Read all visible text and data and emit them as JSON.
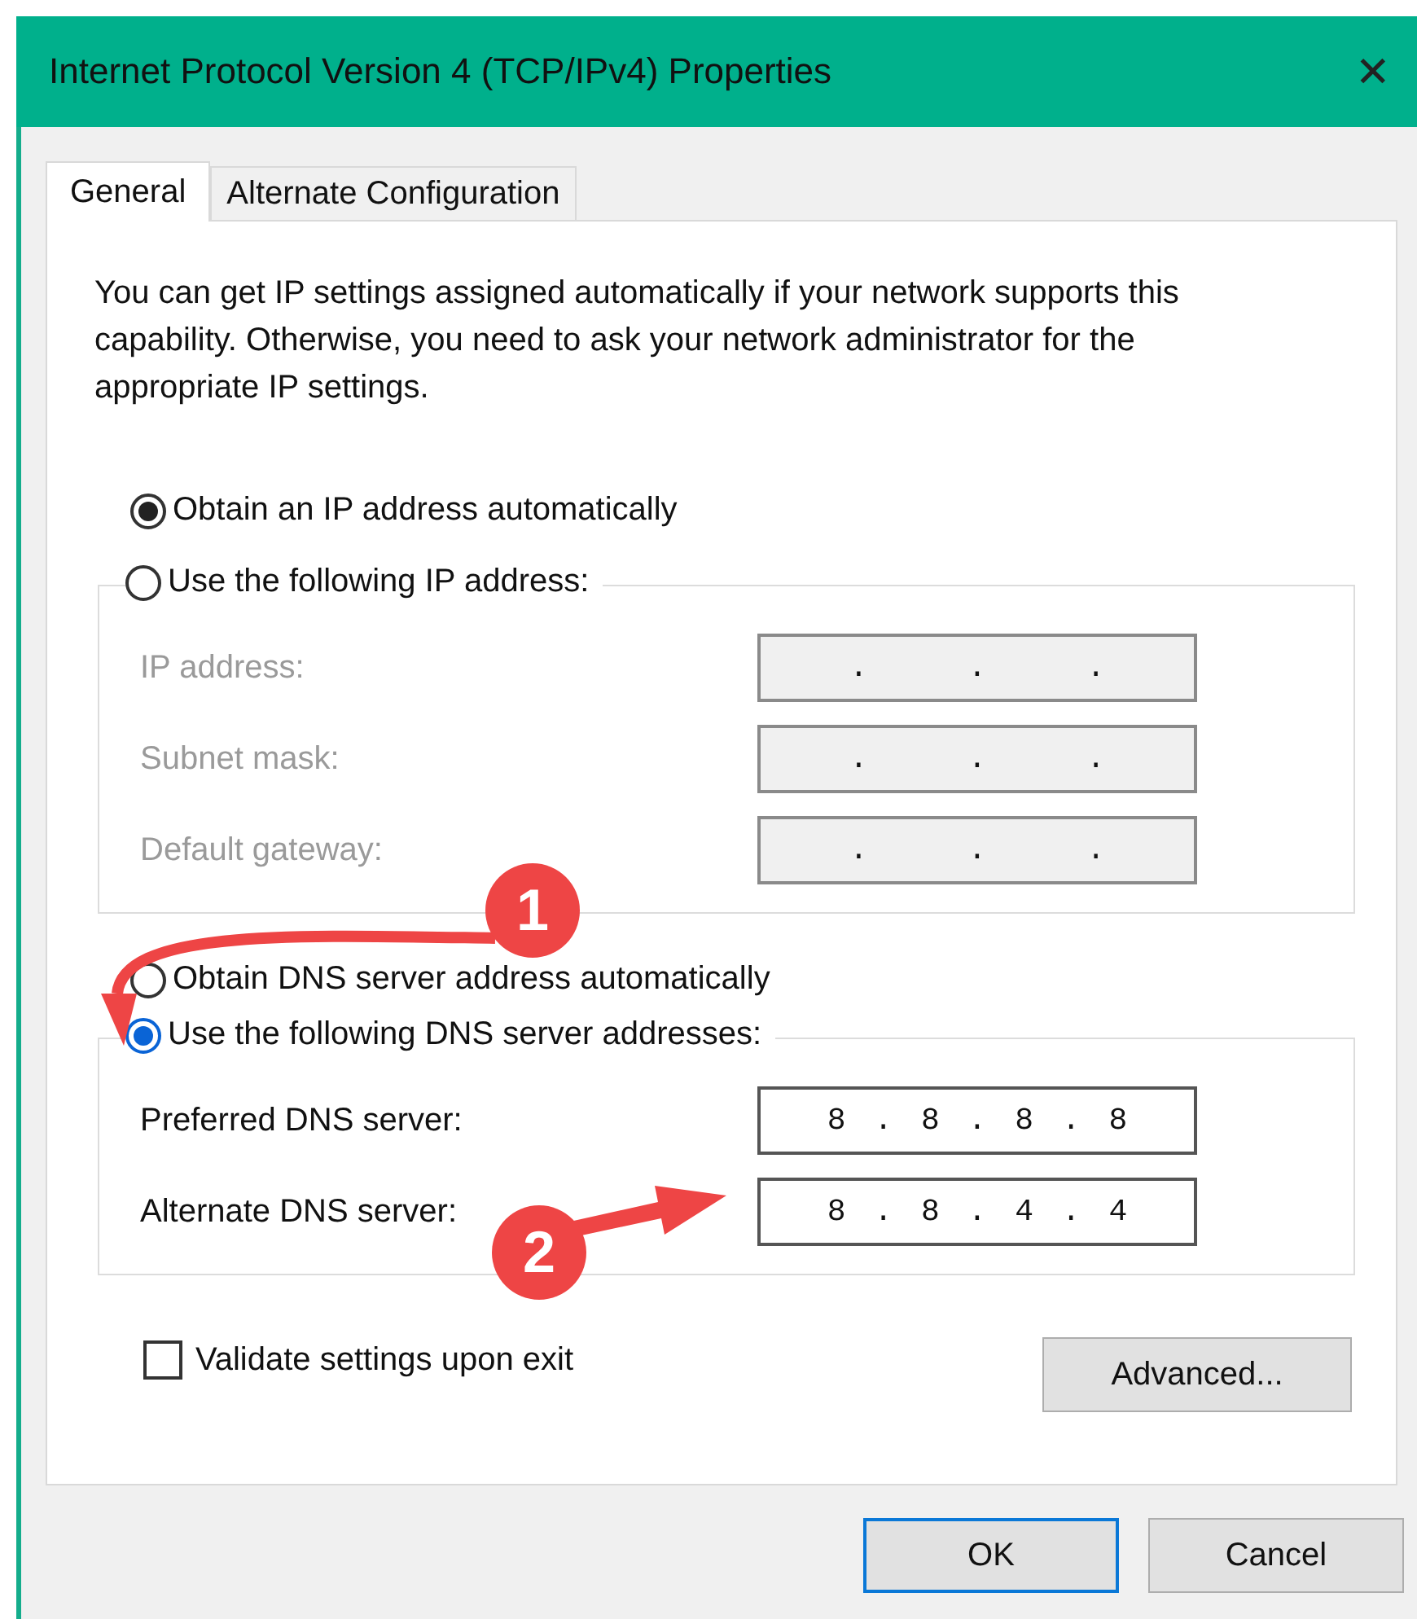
{
  "window": {
    "title": "Internet Protocol Version 4 (TCP/IPv4) Properties",
    "close": "✕"
  },
  "tabs": [
    {
      "label": "General",
      "selected": true
    },
    {
      "label": "Alternate Configuration",
      "selected": false
    }
  ],
  "description": "You can get IP settings assigned automatically if your network supports this capability. Otherwise, you need to ask your network administrator for the appropriate IP settings.",
  "ip_mode": [
    {
      "label": "Obtain an IP address automatically",
      "selected": true
    },
    {
      "label": "Use the following IP address:",
      "selected": false
    }
  ],
  "ip_fields": [
    {
      "label": "IP address:",
      "value": ". . .",
      "disabled": true
    },
    {
      "label": "Subnet mask:",
      "value": ". . .",
      "disabled": true
    },
    {
      "label": "Default gateway:",
      "value": ". . .",
      "disabled": true
    }
  ],
  "dns_mode": [
    {
      "label": "Obtain DNS server address automatically",
      "selected": false
    },
    {
      "label": "Use the following DNS server addresses:",
      "selected": true
    }
  ],
  "dns_fields": [
    {
      "label": "Preferred DNS server:",
      "value": "8 . 8 . 8 . 8",
      "disabled": false
    },
    {
      "label": "Alternate DNS server:",
      "value": "8 . 8 . 4 . 4",
      "disabled": false
    }
  ],
  "validate": {
    "label": "Validate settings upon exit",
    "checked": false
  },
  "advanced_button": "Advanced...",
  "buttons": [
    {
      "label": "OK",
      "default": true
    },
    {
      "label": "Cancel",
      "default": false
    }
  ],
  "annotations": [
    {
      "label": "1"
    },
    {
      "label": "2"
    }
  ]
}
